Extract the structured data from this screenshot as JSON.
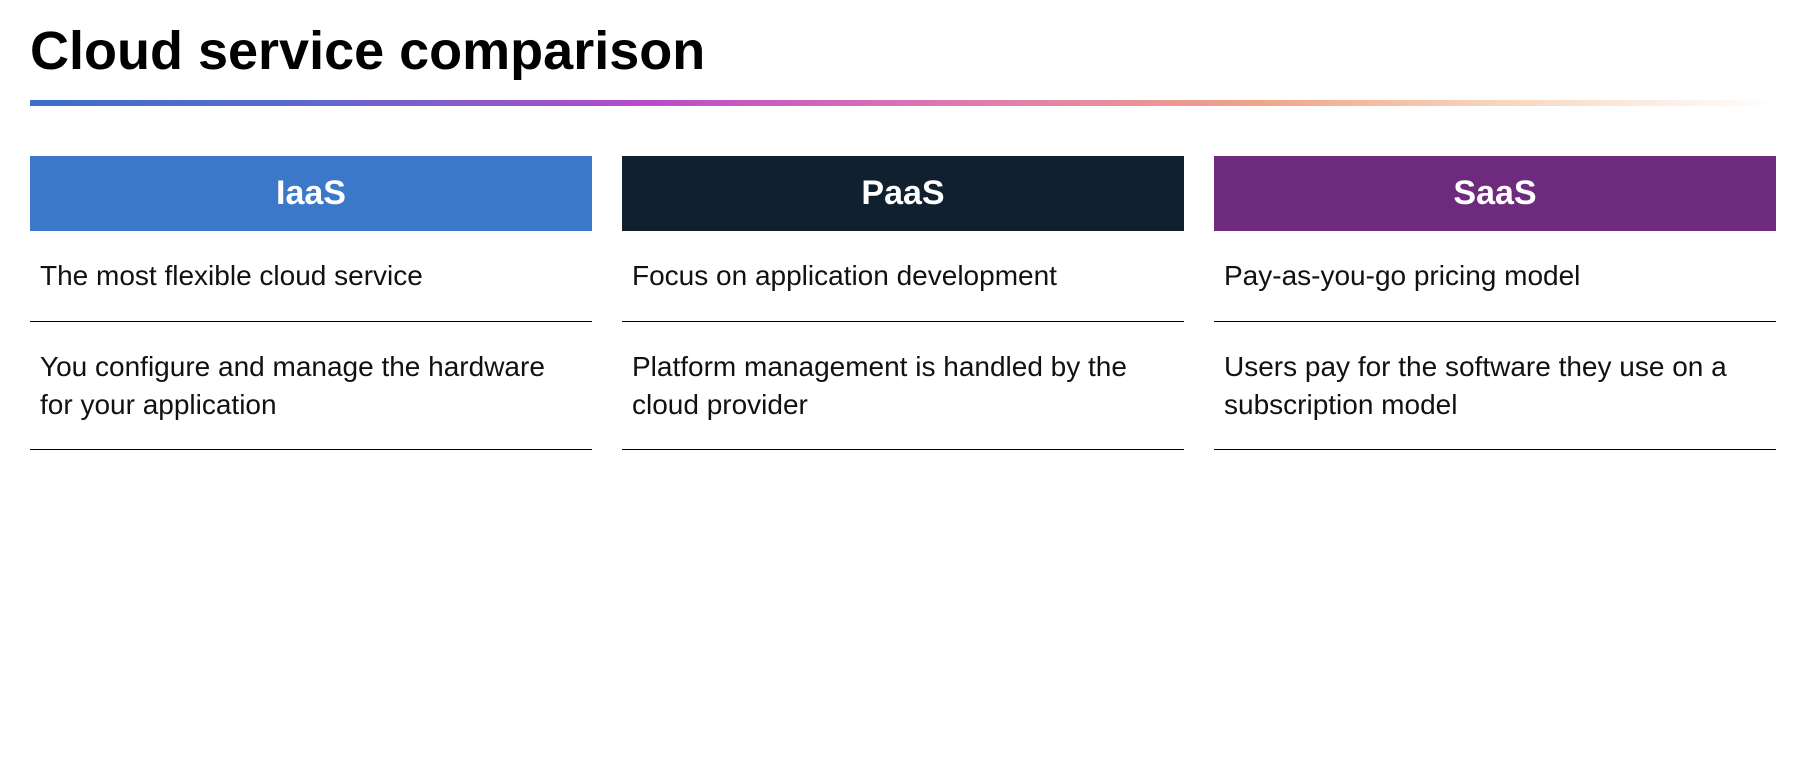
{
  "title": "Cloud service comparison",
  "columns": [
    {
      "header": "IaaS",
      "rows": [
        "The most flexible cloud service",
        "You configure and manage the hardware for your application"
      ]
    },
    {
      "header": "PaaS",
      "rows": [
        "Focus on application development",
        "Platform management is handled by the cloud provider"
      ]
    },
    {
      "header": "SaaS",
      "rows": [
        "Pay-as-you-go pricing model",
        "Users pay for the software they use on a subscription model"
      ]
    }
  ]
}
